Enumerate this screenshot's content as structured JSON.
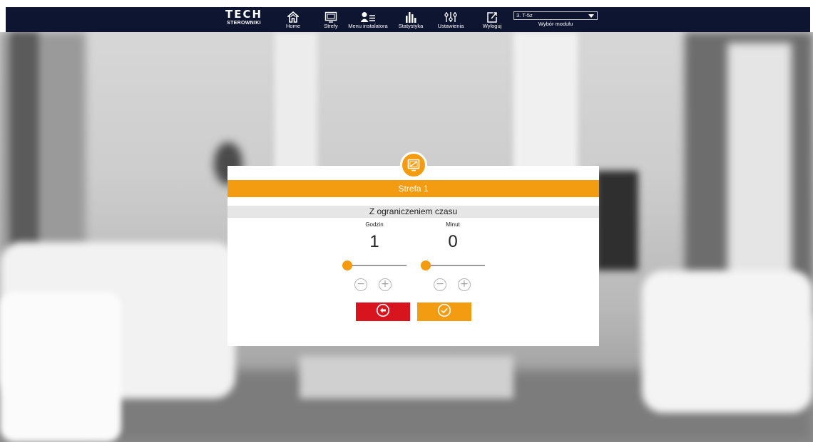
{
  "brand": {
    "logo_text": "TECH",
    "logo_sub": "STEROWNIKI"
  },
  "nav": {
    "items": [
      {
        "label": "Home",
        "icon": "home-icon"
      },
      {
        "label": "Strefy",
        "icon": "zones-icon"
      },
      {
        "label": "Menu instalatora",
        "icon": "installer-icon"
      },
      {
        "label": "Statystyka",
        "icon": "statistics-icon"
      },
      {
        "label": "Ustawienia",
        "icon": "settings-icon"
      },
      {
        "label": "Wyloguj",
        "icon": "logout-icon"
      }
    ],
    "module_select_value": "3. T-5z",
    "module_select_caption": "Wybór modułu"
  },
  "dialog": {
    "icon": "zone-monitor-icon",
    "title": "Strefa 1",
    "subtitle": "Z ograniczeniem czasu",
    "hours": {
      "label": "Godzin",
      "value": "1",
      "slider_fraction": 0.0
    },
    "minutes": {
      "label": "Minut",
      "value": "0",
      "slider_fraction": 0.0
    },
    "minus_glyph": "−",
    "plus_glyph": "+",
    "cancel_icon": "undo-icon",
    "confirm_icon": "check-icon"
  },
  "colors": {
    "accent": "#f39c12",
    "nav_bg": "#0e1530",
    "cancel": "#d8141f"
  }
}
